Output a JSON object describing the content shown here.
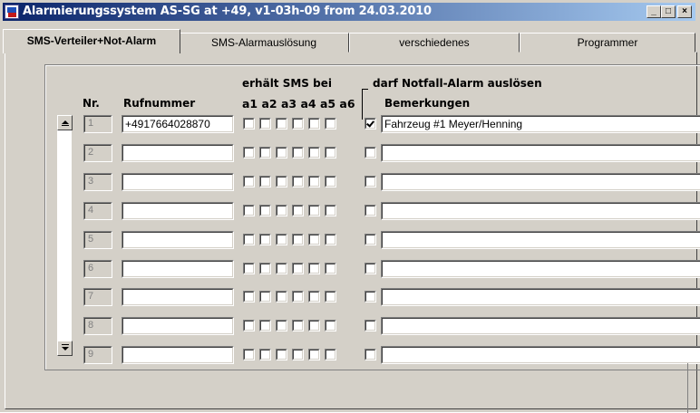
{
  "window": {
    "title": "Alarmierungssystem AS-SG at +49, v1-03h-09 from 24.03.2010",
    "icon": "app-icon",
    "buttons": {
      "minimize": "_",
      "maximize": "□",
      "close": "×"
    }
  },
  "tabs": [
    {
      "label": "SMS-Verteiler+Not-Alarm",
      "active": true
    },
    {
      "label": "SMS-Alarmauslösung",
      "active": false
    },
    {
      "label": "verschiedenes",
      "active": false
    },
    {
      "label": "Programmer",
      "active": false
    }
  ],
  "headers": {
    "nr": "Nr.",
    "rufnummer": "Rufnummer",
    "sms": "erhält SMS bei",
    "alarm_cols": "a1 a2 a3 a4 a5 a6",
    "notfall": "darf Notfall-Alarm auslösen",
    "bemerkungen": "Bemerkungen"
  },
  "rows": [
    {
      "nr": "1",
      "rufnummer": "+4917664028870",
      "sms": [
        false,
        false,
        false,
        false,
        false,
        false
      ],
      "notfall": true,
      "bemerkung": "Fahrzeug #1  Meyer/Henning"
    },
    {
      "nr": "2",
      "rufnummer": "",
      "sms": [
        false,
        false,
        false,
        false,
        false,
        false
      ],
      "notfall": false,
      "bemerkung": ""
    },
    {
      "nr": "3",
      "rufnummer": "",
      "sms": [
        false,
        false,
        false,
        false,
        false,
        false
      ],
      "notfall": false,
      "bemerkung": ""
    },
    {
      "nr": "4",
      "rufnummer": "",
      "sms": [
        false,
        false,
        false,
        false,
        false,
        false
      ],
      "notfall": false,
      "bemerkung": ""
    },
    {
      "nr": "5",
      "rufnummer": "",
      "sms": [
        false,
        false,
        false,
        false,
        false,
        false
      ],
      "notfall": false,
      "bemerkung": ""
    },
    {
      "nr": "6",
      "rufnummer": "",
      "sms": [
        false,
        false,
        false,
        false,
        false,
        false
      ],
      "notfall": false,
      "bemerkung": ""
    },
    {
      "nr": "7",
      "rufnummer": "",
      "sms": [
        false,
        false,
        false,
        false,
        false,
        false
      ],
      "notfall": false,
      "bemerkung": ""
    },
    {
      "nr": "8",
      "rufnummer": "",
      "sms": [
        false,
        false,
        false,
        false,
        false,
        false
      ],
      "notfall": false,
      "bemerkung": ""
    },
    {
      "nr": "9",
      "rufnummer": "",
      "sms": [
        false,
        false,
        false,
        false,
        false,
        false
      ],
      "notfall": false,
      "bemerkung": ""
    }
  ],
  "colors": {
    "title_start": "#0a246a",
    "title_end": "#a6caf0",
    "face": "#d4d0c8"
  }
}
